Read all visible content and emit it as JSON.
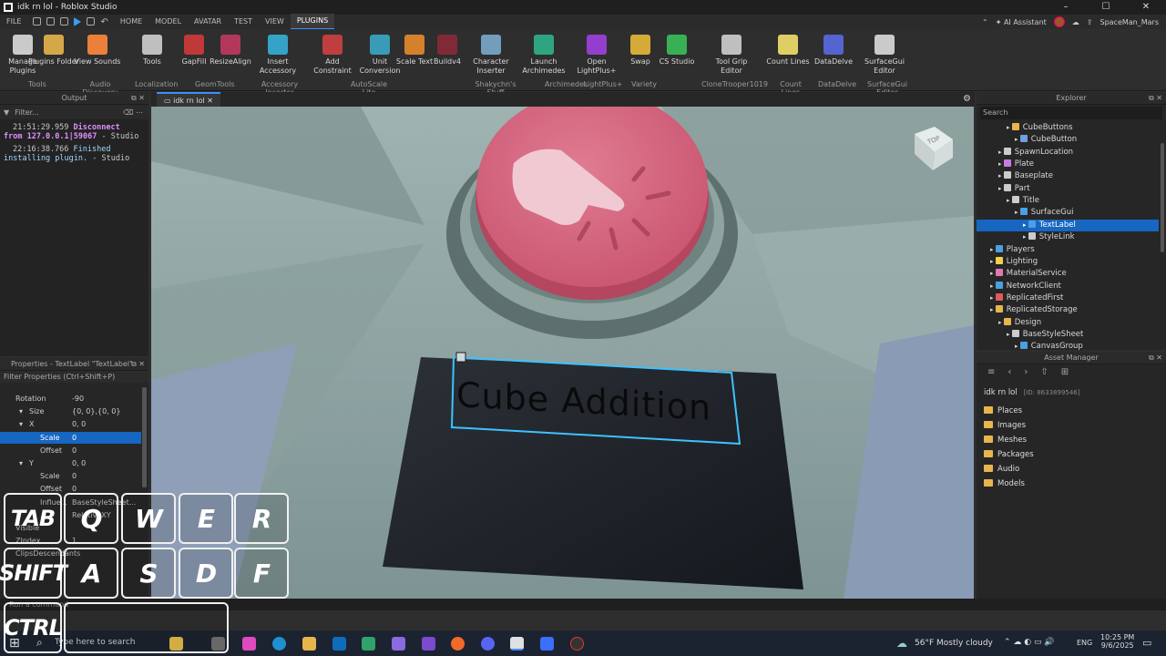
{
  "window": {
    "title": "idk rn lol - Roblox Studio"
  },
  "menu": {
    "tabs": [
      "FILE",
      "HOME",
      "MODEL",
      "AVATAR",
      "TEST",
      "VIEW",
      "PLUGINS"
    ],
    "active_tab": "PLUGINS",
    "assistant": "AI Assistant",
    "username": "SpaceMan_Mars"
  },
  "ribbon": {
    "buttons": [
      {
        "label": "Manage Plugins",
        "color": "#dcdcdc"
      },
      {
        "label": "Plugins Folder",
        "color": "#e7b54c"
      },
      {
        "label": "View Sounds",
        "color": "#ff8a3c"
      },
      {
        "label": "Tools",
        "color": "#cfcfcf"
      },
      {
        "label": "GapFill",
        "color": "#d03a3a"
      },
      {
        "label": "ResizeAlign",
        "color": "#c03a60"
      },
      {
        "label": "Insert Accessory",
        "color": "#35b0d8"
      },
      {
        "label": "Add Constraint",
        "color": "#d04040"
      },
      {
        "label": "Unit Conversion",
        "color": "#3aa8c8"
      },
      {
        "label": "Scale Text",
        "color": "#e88a2a"
      },
      {
        "label": "Buildv4",
        "color": "#8a2a3a"
      },
      {
        "label": "Character Inserter",
        "color": "#7aaacc"
      },
      {
        "label": "Launch Archimedes",
        "color": "#2fb38a"
      },
      {
        "label": "Open LightPlus+",
        "color": "#a040e0"
      },
      {
        "label": "Swap",
        "color": "#e8b83a"
      },
      {
        "label": "CS Studio",
        "color": "#3ac05a"
      },
      {
        "label": "Tool Grip Editor",
        "color": "#cfcfcf"
      },
      {
        "label": "Count Lines",
        "color": "#f2e06a"
      },
      {
        "label": "DataDelve",
        "color": "#5a6ae0"
      },
      {
        "label": "SurfaceGui Editor",
        "color": "#dcdcdc"
      }
    ],
    "groups": [
      "Tools",
      "Audio Discovery",
      "Localization",
      "GeomTools",
      "Accessory Inserter",
      "AutoScale Lite",
      "Shakychn's Stuff",
      "Archimedes",
      "LightPlus+",
      "Variety",
      "CloneTrooper1019",
      "Count Lines",
      "DataDelve",
      "SurfaceGui Editor"
    ]
  },
  "output": {
    "title": "Output",
    "filter_placeholder": "Filter...",
    "lines": [
      {
        "ts": "21:51:29.959",
        "msg": "Disconnect",
        "msg2": "from 127.0.0.1|59067",
        "src": "- Studio"
      },
      {
        "ts": "22:16:38.766",
        "msg": "Finished",
        "msg2": "installing plugin.",
        "src": "- Studio"
      }
    ]
  },
  "properties": {
    "title": "Properties - TextLabel \"TextLabel\"",
    "filter_placeholder": "Filter Properties (Ctrl+Shift+P)",
    "rows": [
      {
        "k": "Rotation",
        "v": "-90"
      },
      {
        "k": "Size",
        "v": "{0, 0},{0, 0}"
      },
      {
        "k": "X",
        "v": "0, 0"
      },
      {
        "k": "Scale",
        "v": "0"
      },
      {
        "k": "Offset",
        "v": "0"
      },
      {
        "k": "Y",
        "v": "0, 0"
      },
      {
        "k": "Scale",
        "v": "0"
      },
      {
        "k": "Offset",
        "v": "0"
      },
      {
        "k": "Influe...",
        "v": "BaseStyleSheet..."
      },
      {
        "k": "...",
        "v": "RelativeXY"
      },
      {
        "k": "Visible",
        "v": ""
      },
      {
        "k": "ZIndex",
        "v": "1"
      },
      {
        "k": "ClipsDescendants",
        "v": ""
      }
    ]
  },
  "viewport": {
    "tab": "idk rn lol",
    "label_text": "Cube Addition",
    "view_cube": "TOP"
  },
  "explorer": {
    "title": "Explorer",
    "search_placeholder": "Search",
    "items": [
      {
        "label": "CubeButtons",
        "indent": 3,
        "icon": "#e7b54c"
      },
      {
        "label": "CubeButton",
        "indent": 4,
        "icon": "#6fa0e0"
      },
      {
        "label": "SpawnLocation",
        "indent": 2,
        "icon": "#cccccc"
      },
      {
        "label": "Plate",
        "indent": 2,
        "icon": "#c77be0"
      },
      {
        "label": "Baseplate",
        "indent": 2,
        "icon": "#cccccc"
      },
      {
        "label": "Part",
        "indent": 2,
        "icon": "#cccccc"
      },
      {
        "label": "Title",
        "indent": 3,
        "icon": "#cccccc"
      },
      {
        "label": "SurfaceGui",
        "indent": 4,
        "icon": "#4aa0e0"
      },
      {
        "label": "TextLabel",
        "indent": 5,
        "icon": "#4aa0e0"
      },
      {
        "label": "StyleLink",
        "indent": 5,
        "icon": "#cccccc"
      },
      {
        "label": "Players",
        "indent": 1,
        "icon": "#4aa0e0"
      },
      {
        "label": "Lighting",
        "indent": 1,
        "icon": "#f2d04a"
      },
      {
        "label": "MaterialService",
        "indent": 1,
        "icon": "#e07bb0"
      },
      {
        "label": "NetworkClient",
        "indent": 1,
        "icon": "#4aa0e0"
      },
      {
        "label": "ReplicatedFirst",
        "indent": 1,
        "icon": "#e05a5a"
      },
      {
        "label": "ReplicatedStorage",
        "indent": 1,
        "icon": "#e7b54c"
      },
      {
        "label": "Design",
        "indent": 2,
        "icon": "#e7b54c"
      },
      {
        "label": "BaseStyleSheet",
        "indent": 3,
        "icon": "#cccccc"
      },
      {
        "label": "CanvasGroup",
        "indent": 4,
        "icon": "#4aa0e0"
      }
    ],
    "selected": "TextLabel"
  },
  "asset_manager": {
    "title": "Asset Manager",
    "place": "idk rn lol",
    "place_id": "[ID: 8633899546]",
    "folders": [
      "Places",
      "Images",
      "Meshes",
      "Packages",
      "Audio",
      "Models"
    ]
  },
  "command_bar": {
    "placeholder": "Run a command"
  },
  "taskbar": {
    "search": "Type here to search",
    "weather": "56°F  Mostly cloudy",
    "lang": "ENG",
    "time": "10:25 PM",
    "date": "9/6/2025"
  },
  "keys": [
    {
      "k": "TAB"
    },
    {
      "k": "Q"
    },
    {
      "k": "W"
    },
    {
      "k": "E"
    },
    {
      "k": "R"
    },
    {
      "k": "SHIFT"
    },
    {
      "k": "A"
    },
    {
      "k": "S"
    },
    {
      "k": "D"
    },
    {
      "k": "F"
    },
    {
      "k": "CTRL"
    },
    {
      "k": ""
    }
  ]
}
